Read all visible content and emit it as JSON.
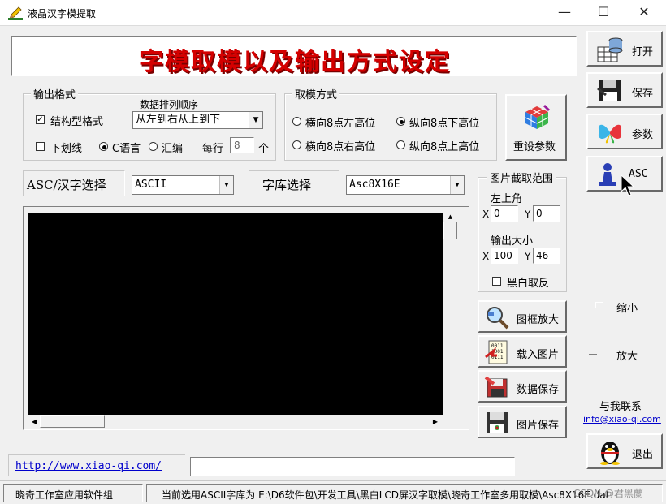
{
  "window": {
    "title": "液晶汉字模提取",
    "minimize": "—",
    "maximize": "☐",
    "close": "✕"
  },
  "banner": {
    "text": "字模取模以及输出方式设定",
    "color": "#d40000"
  },
  "output_format": {
    "legend": "输出格式",
    "struct_checkbox": {
      "label": "结构型格式",
      "checked": true
    },
    "order_label": "数据排列顺序",
    "order_select": "从左到右从上到下",
    "underline_checkbox": {
      "label": "下划线",
      "checked": false
    },
    "lang_c": "C语言",
    "lang_asm": "汇编",
    "per_row_label": "每行",
    "per_row_value": "8",
    "per_row_unit": "个"
  },
  "mode": {
    "legend": "取模方式",
    "opt1": "横向8点左高位",
    "opt2": "纵向8点下高位",
    "opt3": "横向8点右高位",
    "opt4": "纵向8点上高位",
    "selected": "纵向8点下高位"
  },
  "reset_button": "重设参数",
  "asc_select": {
    "label": "ASC/汉字选择",
    "value": "ASCII"
  },
  "font_select": {
    "label": "字库选择",
    "value": "Asc8X16E"
  },
  "crop": {
    "legend": "图片截取范围",
    "top_left": "左上角",
    "x_label": "X",
    "y_label": "Y",
    "x_val": "0",
    "y_val": "0",
    "out_size": "输出大小",
    "w_val": "100",
    "h_val": "46",
    "bw_label": "黑白取反"
  },
  "actions": {
    "zoom": "图框放大",
    "load": "载入图片",
    "save_data": "数据保存",
    "save_img": "图片保存"
  },
  "right_toolbar": {
    "open": "打开",
    "save": "保存",
    "params": "参数",
    "asc": "ASC",
    "exit": "退出"
  },
  "zoom_slider": {
    "shrink": "缩小",
    "enlarge": "放大"
  },
  "contact": {
    "label": "与我联系",
    "email": "info@xiao-qi.com"
  },
  "link": "http://www.xiao-qi.com/",
  "status": {
    "left": "晓奇工作室应用软件组",
    "right": "当前选用ASCII字库为 E:\\D6软件包\\开发工具\\黑白LCD屏汉字取模\\晓奇工作室多用取模\\Asc8X16E.dat"
  },
  "watermark": "CSDN @君黑蘭"
}
